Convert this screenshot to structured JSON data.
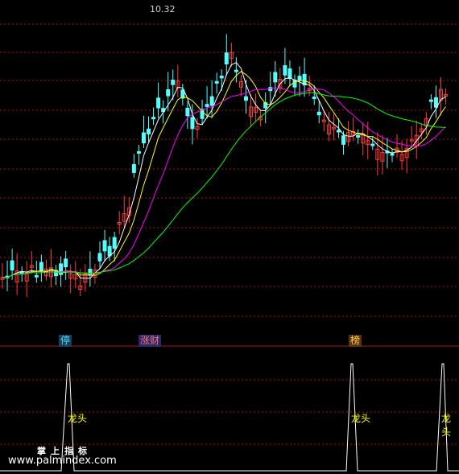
{
  "chart_data": [
    {
      "type": "candlestick",
      "title": "",
      "annotations": {
        "high_price": "10.32"
      },
      "markers": [
        "停",
        "涨财",
        "榜"
      ],
      "moving_average_colors": [
        "#ffffff",
        "#ffff00",
        "#ff00ff",
        "#00ff00"
      ],
      "up_color": "#ff3b3b",
      "down_color": "#54ffff",
      "grid": true,
      "grid_color": "#b01212"
    },
    {
      "type": "line",
      "title": "",
      "line_color": "#ffffff",
      "label_color": "#ffff00",
      "peak_labels": [
        "龙头",
        "龙头",
        "龙头"
      ]
    }
  ],
  "watermark": {
    "title": "掌上指标",
    "url": "www.palmindex.com"
  }
}
